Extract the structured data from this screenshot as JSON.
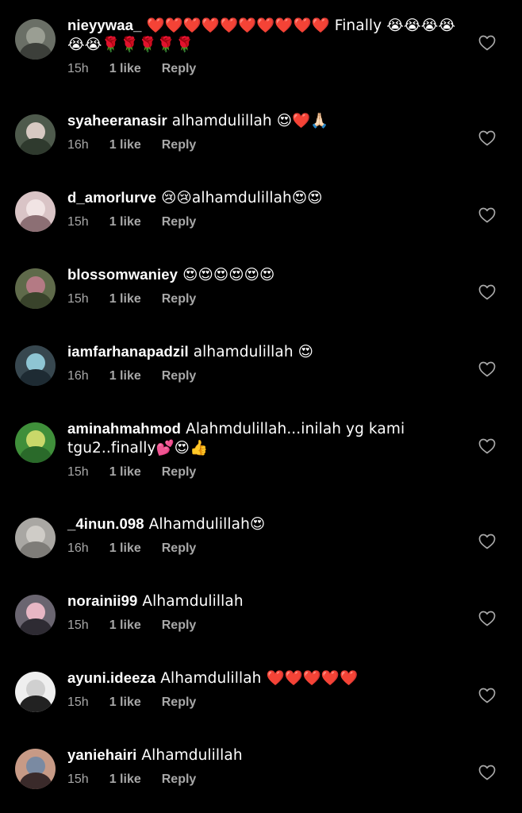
{
  "colors": {
    "background": "#000000",
    "text": "#ffffff",
    "secondary": "#a8a8a8"
  },
  "comments": [
    {
      "username": "nieyywaa_",
      "text": "❤️❤️❤️❤️❤️❤️❤️❤️❤️❤️ Finally 😭😭😭😭😭😭🌹🌹🌹🌹🌹",
      "time": "15h",
      "likes": "1 like",
      "reply": "Reply",
      "avatar_colors": [
        "#6a6f66",
        "#9a9e93",
        "#3c3f3a"
      ],
      "heart_icon": "heart-outline-icon"
    },
    {
      "username": "syaheeranasir",
      "text": "alhamdulillah 😍❤️🙏🏻",
      "time": "16h",
      "likes": "1 like",
      "reply": "Reply",
      "avatar_colors": [
        "#4e5a4c",
        "#d7c9c2",
        "#2f3a2e"
      ],
      "heart_icon": "heart-outline-icon"
    },
    {
      "username": "d_amorlurve",
      "text": "😢😢alhamdulillah😍😍",
      "time": "15h",
      "likes": "1 like",
      "reply": "Reply",
      "avatar_colors": [
        "#d9c4c6",
        "#f1e4e4",
        "#8c6f74"
      ],
      "heart_icon": "heart-outline-icon"
    },
    {
      "username": "blossomwaniey",
      "text": "😍😍😍😍😍😍",
      "time": "15h",
      "likes": "1 like",
      "reply": "Reply",
      "avatar_colors": [
        "#5f6a4a",
        "#b47a84",
        "#39432b"
      ],
      "heart_icon": "heart-outline-icon"
    },
    {
      "username": "iamfarhanapadzil",
      "text": "alhamdulillah 😍",
      "time": "16h",
      "likes": "1 like",
      "reply": "Reply",
      "avatar_colors": [
        "#37474f",
        "#8ec5d3",
        "#1e2b33"
      ],
      "heart_icon": "heart-outline-icon"
    },
    {
      "username": "aminahmahmod",
      "text": "Alahmdulillah...inilah yg kami tgu2..finally💕😍👍",
      "time": "15h",
      "likes": "1 like",
      "reply": "Reply",
      "avatar_colors": [
        "#3f8f3a",
        "#c9d86a",
        "#2a6a2a"
      ],
      "heart_icon": "heart-outline-icon"
    },
    {
      "username": "_4inun.098",
      "text": "Alhamdulillah😍",
      "time": "16h",
      "likes": "1 like",
      "reply": "Reply",
      "avatar_colors": [
        "#a9a7a3",
        "#cfccc7",
        "#7e7c78"
      ],
      "heart_icon": "heart-outline-icon"
    },
    {
      "username": "norainii99",
      "text": "Alhamdulillah",
      "time": "15h",
      "likes": "1 like",
      "reply": "Reply",
      "avatar_colors": [
        "#6a6570",
        "#e7b6c4",
        "#2e2b33"
      ],
      "heart_icon": "heart-outline-icon"
    },
    {
      "username": "ayuni.ideeza",
      "text": "Alhamdulillah ❤️❤️❤️❤️❤️",
      "time": "15h",
      "likes": "1 like",
      "reply": "Reply",
      "avatar_colors": [
        "#efefef",
        "#d0d0d0",
        "#222222"
      ],
      "heart_icon": "heart-outline-icon"
    },
    {
      "username": "yaniehairi",
      "text": "Alhamdulillah",
      "time": "15h",
      "likes": "1 like",
      "reply": "Reply",
      "avatar_colors": [
        "#c79a86",
        "#7a8aa2",
        "#3a2a2a"
      ],
      "heart_icon": "heart-outline-icon"
    }
  ]
}
